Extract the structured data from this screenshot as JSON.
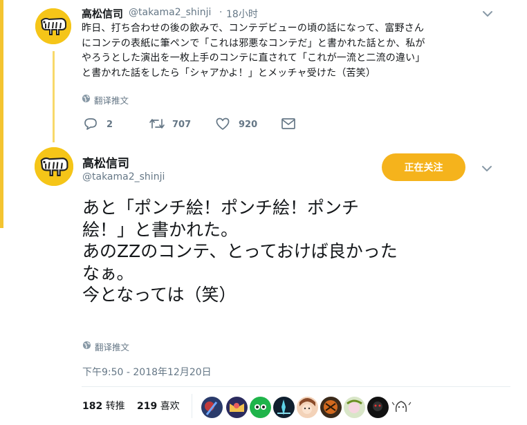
{
  "thread": {
    "first_tweet": {
      "author_name": "高松信司",
      "handle": "@takama2_shinji",
      "separator": "·",
      "time": "18小时",
      "body_lines": [
        "昨日、打ち合わせの後の飲みで、コンテデビューの頃の話になって、富野さん",
        "にコンテの表紙に筆ペンで「これは邪悪なコンテだ」と書かれた話とか、私が",
        "やろうとした演出を一枚上手のコンテに直されて「これが一流と二流の違い」",
        "と書かれた話をしたら「シャアかよ！」とメッチャ受けた（苦笑）"
      ],
      "translate_label": "翻译推文",
      "reply_count": "2",
      "retweet_count": "707",
      "like_count": "920"
    },
    "main_tweet": {
      "author_name": "高松信司",
      "handle": "@takama2_shinji",
      "follow_label": "正在关注",
      "body_lines": [
        "あと「ポンチ絵！ポンチ絵！ポンチ",
        "絵！」と書かれた。",
        "あのZZのコンテ、とっておけば良かった",
        "なぁ。",
        "今となっては（笑）"
      ],
      "translate_label": "翻译推文",
      "timestamp": "下午9:50 - 2018年12月20日",
      "retweets_count": "182",
      "retweets_label": "转推",
      "likes_count": "219",
      "likes_label": "喜欢"
    }
  },
  "colors": {
    "accent": "#f5b31c",
    "avatar_bg": "#f5c518",
    "thread_line": "#f8d96a",
    "muted_text": "#657786"
  },
  "icons": {
    "reply": "reply-icon",
    "retweet": "retweet-icon",
    "like": "heart-icon",
    "dm": "envelope-icon",
    "translate": "globe-icon",
    "menu": "chevron-down-icon"
  }
}
